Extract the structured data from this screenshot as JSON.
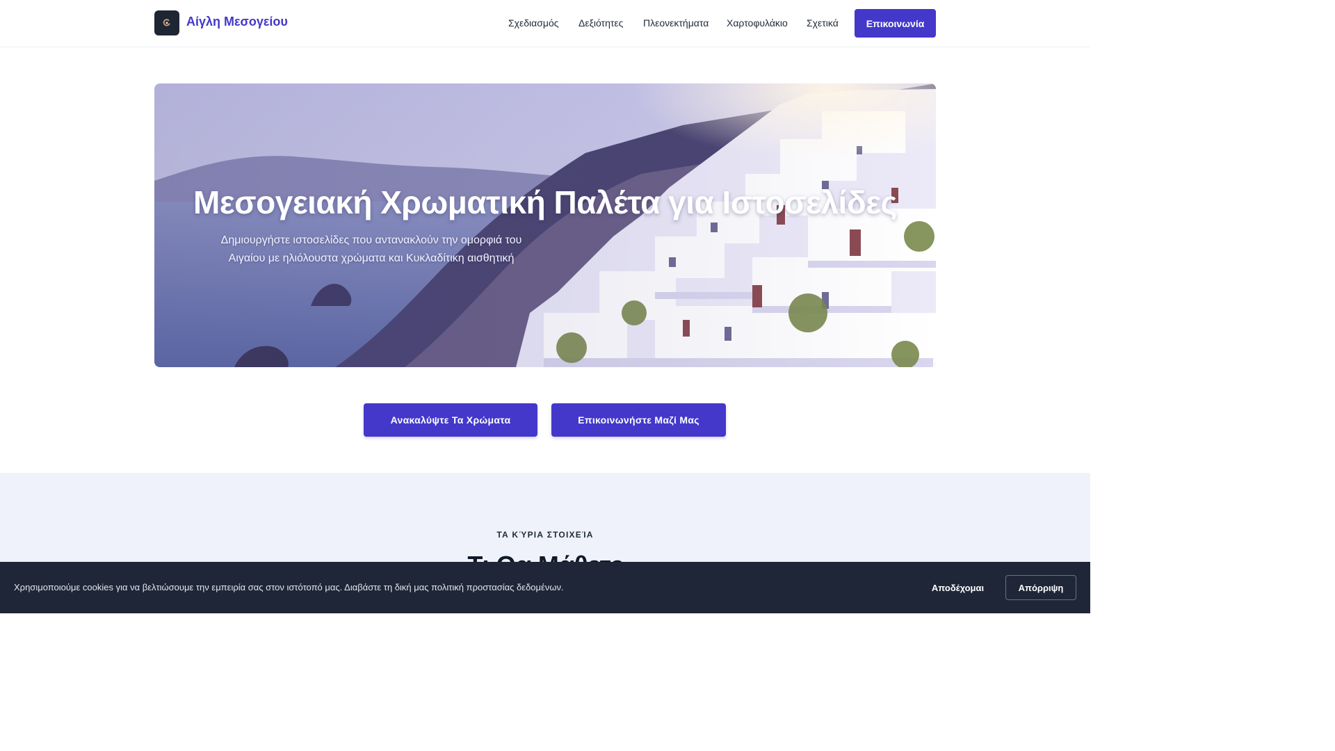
{
  "header": {
    "brand": "Αίγλη Μεσογείου",
    "nav": [
      "Σχεδιασμός",
      "Δεξιότητες",
      "Πλεονεκτήματα",
      "Χαρτοφυλάκιο",
      "Σχετικά"
    ],
    "contact_label": "Επικοινωνία"
  },
  "hero": {
    "title": "Μεσογειακή Χρωματική Παλέτα για Ιστοσελίδες",
    "subtitle": "Δημιουργήστε ιστοσελίδες που αντανακλούν την ομορφιά του Αιγαίου με ηλιόλουστα χρώματα και Κυκλαδίτικη αισθητική",
    "image_icon": "santorini-photo"
  },
  "cta": {
    "primary": "Ανακαλύψτε Τα Χρώματα",
    "secondary": "Επικοινωνήστε Μαζί Μας"
  },
  "features": {
    "eyebrow": "ΤΑ ΚΎΡΙΑ ΣΤΟΙΧΕΊΑ",
    "title": "Τι Θα Μάθετε"
  },
  "cookie": {
    "text": "Χρησιμοποιούμε cookies για να βελτιώσουμε την εμπειρία σας στον ιστότοπό μας. Διαβάστε τη δική μας πολιτική προστασίας δεδομένων.",
    "accept": "Αποδέχομαι",
    "reject": "Απόρριψη"
  },
  "colors": {
    "accent": "#4338ca",
    "section_bg": "#eff2fb",
    "banner_bg": "#1e2638"
  }
}
